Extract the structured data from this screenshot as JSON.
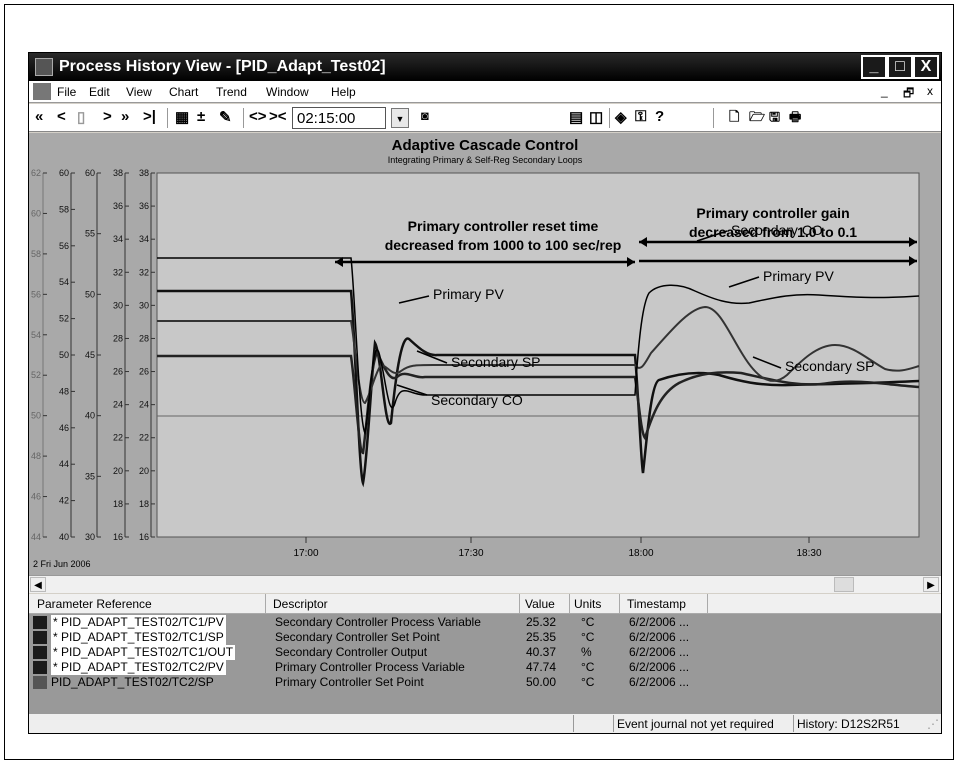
{
  "window": {
    "title": "Process History View - [PID_Adapt_Test02]",
    "controls": {
      "minimize": "_",
      "maximize": "□",
      "close": "X"
    }
  },
  "menu": {
    "items": [
      "File",
      "Edit",
      "View",
      "Chart",
      "Trend",
      "Window",
      "Help"
    ],
    "mdi_controls": [
      "_",
      "🗗",
      "x"
    ]
  },
  "toolbar": {
    "time_value": "02:15:00",
    "nav_glyphs": [
      "«",
      "<",
      "▯",
      ">",
      "»",
      ">|"
    ],
    "mid_glyphs": [
      "▦",
      "±",
      "✎",
      "<>",
      "><"
    ],
    "right_glyphs": [
      "▤",
      "◫",
      "◈",
      "⚿",
      "?"
    ],
    "file_glyphs": [
      "🗋",
      "🗁",
      "🖫",
      "🖶"
    ]
  },
  "chart_data": {
    "type": "line",
    "title": "Adaptive Cascade Control",
    "subtitle": "Integrating Primary & Self-Reg Secondary Loops",
    "date_label": "2 Fri Jun 2006",
    "x_ticks": [
      "17:00",
      "17:30",
      "18:00",
      "18:30"
    ],
    "axes": [
      {
        "ticks": [
          62,
          60,
          58,
          56,
          54,
          52,
          50,
          48,
          46,
          44
        ],
        "labels": [
          "62",
          "60",
          "58",
          "56",
          "54",
          "52",
          "50",
          "48",
          "46",
          "44"
        ]
      },
      {
        "ticks": [
          60,
          58,
          56,
          54,
          52,
          50,
          48,
          46,
          44,
          42,
          40
        ],
        "labels": [
          "60",
          "58",
          "56",
          "54",
          "52",
          "50",
          "48",
          "46",
          "44",
          "42",
          "40"
        ]
      },
      {
        "ticks": [
          60,
          55,
          50,
          45,
          40,
          35,
          30
        ],
        "labels": [
          "60",
          "55",
          "50",
          "45",
          "40",
          "35",
          "30"
        ]
      },
      {
        "ticks": [
          38,
          36,
          34,
          32,
          30,
          28,
          26,
          24,
          22,
          20,
          18,
          16
        ],
        "labels": [
          "38",
          "36",
          "34",
          "32",
          "30",
          "28",
          "26",
          "24",
          "22",
          "20",
          "18",
          "16"
        ]
      },
      {
        "ticks": [
          38,
          36,
          34,
          32,
          30,
          28,
          26,
          24,
          22,
          20,
          18,
          16
        ],
        "labels": [
          "38",
          "36",
          "34",
          "32",
          "30",
          "28",
          "26",
          "24",
          "22",
          "20",
          "18",
          "16"
        ]
      }
    ],
    "annotations": [
      {
        "line1": "Primary controller reset time",
        "line2": "decreased from 1000 to 100 sec/rep"
      },
      {
        "line1": "Primary controller gain",
        "line2": "decreased from 1.0 to 0.1"
      }
    ],
    "series_labels": {
      "pv_left": "Primary PV",
      "sp_left": "Secondary SP",
      "co_left": "Secondary CO",
      "co_right": "Secondary CO",
      "pv_right": "Primary PV",
      "sp_right": "Secondary SP"
    }
  },
  "table": {
    "headers": [
      "Parameter Reference",
      "Descriptor",
      "Value",
      "Units",
      "Timestamp"
    ],
    "rows": [
      {
        "ref": "* PID_ADAPT_TEST02/TC1/PV",
        "desc": "Secondary Controller Process Variable",
        "value": "25.32",
        "units": "°C",
        "ts": "6/2/2006 ..."
      },
      {
        "ref": "* PID_ADAPT_TEST02/TC1/SP",
        "desc": "Secondary Controller Set Point",
        "value": "25.35",
        "units": "°C",
        "ts": "6/2/2006 ..."
      },
      {
        "ref": "* PID_ADAPT_TEST02/TC1/OUT",
        "desc": "Secondary Controller Output",
        "value": "40.37",
        "units": "%",
        "ts": "6/2/2006 ..."
      },
      {
        "ref": "* PID_ADAPT_TEST02/TC2/PV",
        "desc": "Primary Controller Process Variable",
        "value": "47.74",
        "units": "°C",
        "ts": "6/2/2006 ..."
      },
      {
        "ref": "PID_ADAPT_TEST02/TC2/SP",
        "desc": "Primary Controller Set Point",
        "value": "50.00",
        "units": "°C",
        "ts": "6/2/2006 ..."
      }
    ]
  },
  "status": {
    "journal": "Event journal not yet required",
    "history": "History: D12S2R51"
  }
}
